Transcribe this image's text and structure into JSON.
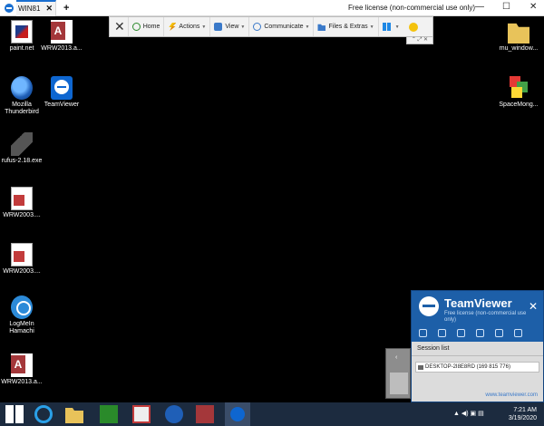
{
  "titlebar": {
    "tab_label": "WIN81",
    "tab_close": "✕",
    "tab_add": "+",
    "license": "Free license (non-commercial use only)",
    "min": "—",
    "max": "☐",
    "close": "✕"
  },
  "toolbar": {
    "close": "✕",
    "home": "Home",
    "actions": "Actions",
    "view": "View",
    "communicate": "Communicate",
    "files": "Files & Extras",
    "dropdown": "▼",
    "sub": "⌃ ⤢ ✕"
  },
  "desktop": {
    "icons": [
      {
        "label": "paint.net"
      },
      {
        "label": "WRW2013.a..."
      },
      {
        "label": "Mozilla Thunderbird"
      },
      {
        "label": "TeamViewer"
      },
      {
        "label": "rufus-2.18.exe"
      },
      {
        "label": "WRW2003...."
      },
      {
        "label": "WRW2003...."
      },
      {
        "label": "LogMeIn Hamachi"
      },
      {
        "label": "WRW2013.a..."
      },
      {
        "label": "mu_window..."
      },
      {
        "label": "SpaceMong..."
      }
    ]
  },
  "tvpanel": {
    "brand": "TeamViewer",
    "free_license": "Free license (non-commercial use only)",
    "close": "✕",
    "session_list": "Session list",
    "session_row": "DESKTOP-2I8E8RD (169 815 776)",
    "url": "www.teamviewer.com"
  },
  "avatar": {
    "arrow": "‹"
  },
  "taskbar": {
    "tray": "▲  ◀)  ▣  ▤",
    "time": "7:21 AM",
    "date": "3/19/2020"
  },
  "colors": {
    "desktop_bg": "#000000",
    "taskbar_bg": "#1c2b3f",
    "teamviewer_blue": "#1d5fa8"
  }
}
